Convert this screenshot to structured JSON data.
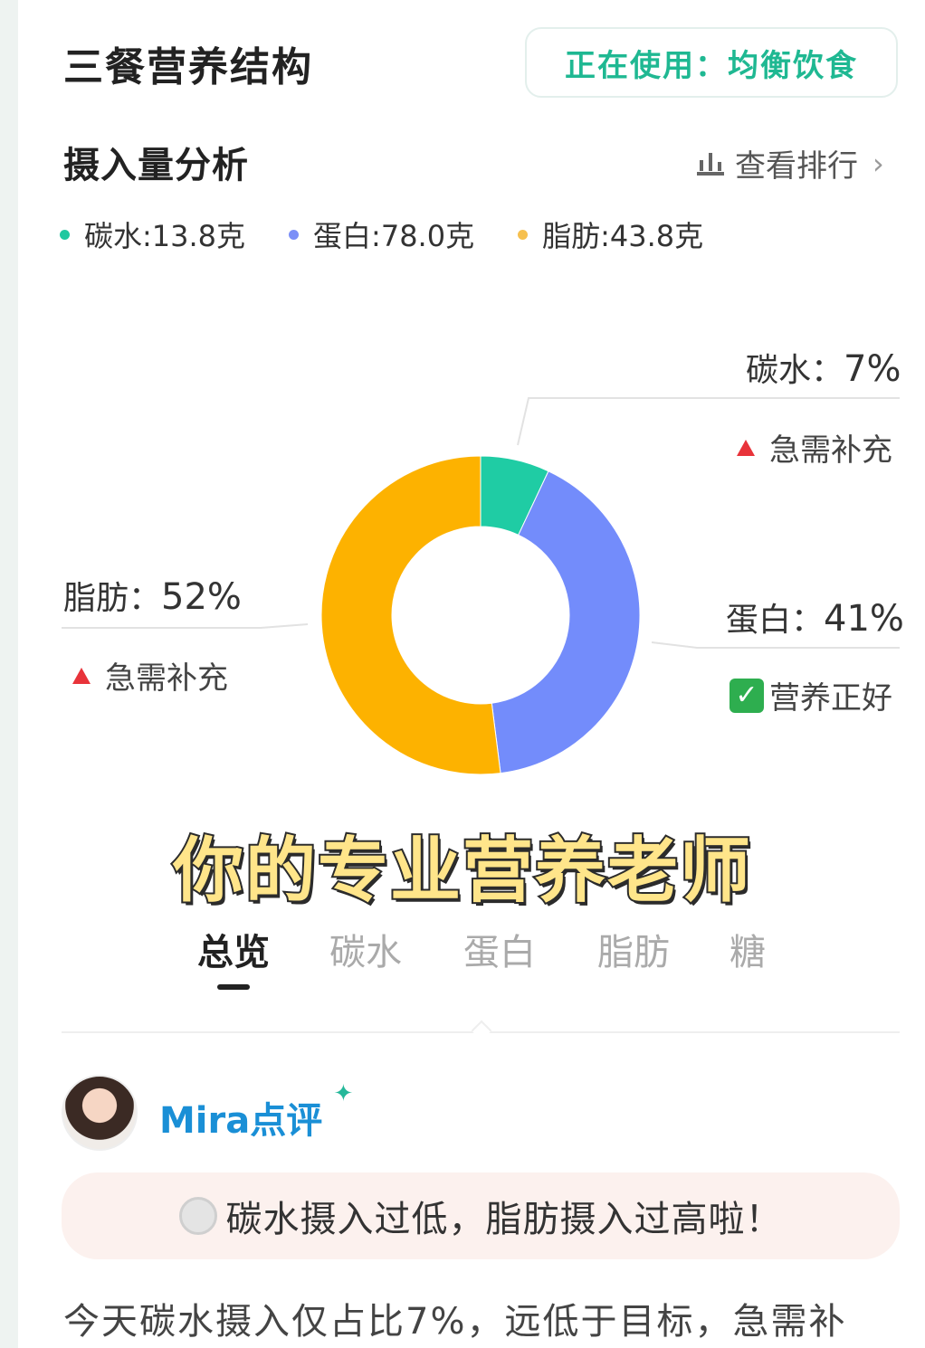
{
  "header": {
    "title": "三餐营养结构",
    "diet_badge": "正在使用：均衡饮食"
  },
  "section": {
    "title": "摄入量分析",
    "rank_link": "查看排行"
  },
  "legend": [
    {
      "label": "碳水:13.8克",
      "color": "#20c8a0"
    },
    {
      "label": "蛋白:78.0克",
      "color": "#7b8ff7"
    },
    {
      "label": "脂肪:43.8克",
      "color": "#f6c04f"
    }
  ],
  "chart_data": {
    "type": "pie",
    "donut": true,
    "series": [
      {
        "name": "碳水",
        "value": 7,
        "color": "#1fcca4"
      },
      {
        "name": "蛋白",
        "value": 41,
        "color": "#738cfb"
      },
      {
        "name": "脂肪",
        "value": 52,
        "color": "#fdb200"
      }
    ],
    "callouts": [
      {
        "label": "碳水：",
        "pct": "7%",
        "status": "急需补充",
        "status_icon": "warning-triangle-icon"
      },
      {
        "label": "蛋白：",
        "pct": "41%",
        "status": "营养正好",
        "status_icon": "check-icon"
      },
      {
        "label": "脂肪：",
        "pct": "52%",
        "status": "急需补充",
        "status_icon": "warning-triangle-icon"
      }
    ]
  },
  "banner": "你的专业营养老师",
  "tabs": [
    "总览",
    "碳水",
    "蛋白",
    "脂肪",
    "糖"
  ],
  "active_tab": "总览",
  "review": {
    "title": "Mira点评",
    "alert": "碳水摄入过低，脂肪摄入过高啦！",
    "body": "今天碳水摄入仅占比7%，远低于目标，急需补"
  }
}
